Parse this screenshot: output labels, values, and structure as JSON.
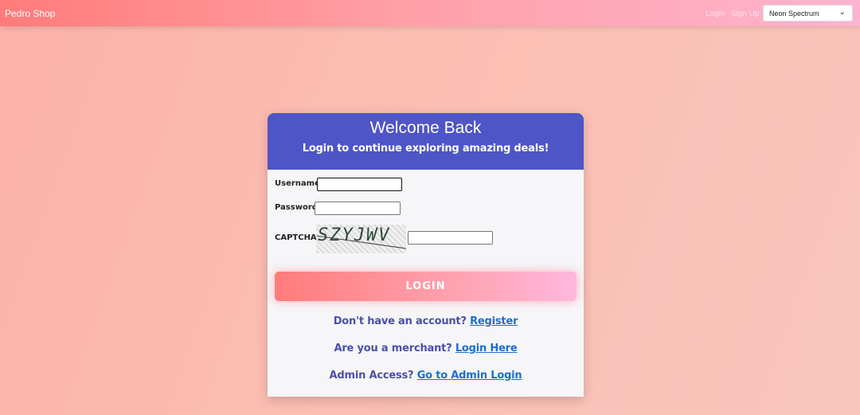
{
  "navbar": {
    "brand": "Pedro Shop",
    "login_link": "Login",
    "signup_link": "Sign Up",
    "theme_selected": "Neon Spectrum"
  },
  "card": {
    "title": "Welcome Back",
    "subtitle": "Login to continue exploring amazing deals!",
    "username_label": "Username",
    "username_value": "",
    "password_label": "Password",
    "password_value": "",
    "captcha_label": "CAPTCHA",
    "captcha_text": "SZYJWV",
    "captcha_value": "",
    "login_button": "LOGIN",
    "register_prompt": "Don't have an account?",
    "register_link": "Register",
    "merchant_prompt": "Are you a merchant?",
    "merchant_link": "Login Here",
    "admin_prompt": "Admin Access?",
    "admin_link": "Go to Admin Login"
  },
  "colors": {
    "header": "#4e55c6",
    "link": "#1a6fd0",
    "prompt": "#4a4fa8",
    "accent_start": "#ff7b7b",
    "accent_end": "#ffb8dc"
  }
}
